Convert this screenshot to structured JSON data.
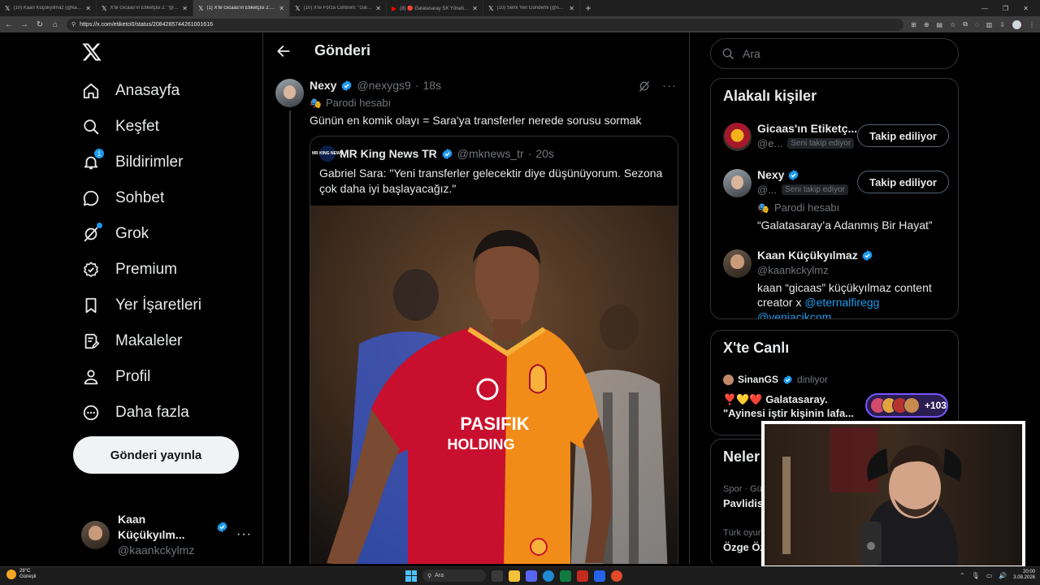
{
  "browser": {
    "tabs": [
      {
        "title": "(10) Kaan Küçükyılmaz (@kaankc",
        "icon": "x-icon",
        "active": false
      },
      {
        "title": "X'te Gicaas'ın Etiketçisi 2: \"@forzag",
        "icon": "x-icon",
        "active": false
      },
      {
        "title": "(1) X'te Gicaas'ın Etiketçisi 2: \"@ne",
        "icon": "x-icon",
        "active": true
      },
      {
        "title": "(10) X'te Forza Cimbom: \"Galatas",
        "icon": "x-icon",
        "active": false
      },
      {
        "title": "(8) 🔴 Galatasaray SK Yönetim Ku",
        "icon": "youtube-icon",
        "active": false
      },
      {
        "title": "(10) Semi Yeri Gündemi (@semiyer",
        "icon": "x-icon",
        "active": false
      }
    ],
    "url": "https://x.com/etiketci0/status/2084285744261001616"
  },
  "sidebar": {
    "nav": [
      {
        "label": "Anasayfa",
        "icon": "home-icon"
      },
      {
        "label": "Keşfet",
        "icon": "search-icon"
      },
      {
        "label": "Bildirimler",
        "icon": "bell-icon",
        "badge": "1"
      },
      {
        "label": "Sohbet",
        "icon": "chat-icon"
      },
      {
        "label": "Grok",
        "icon": "grok-icon"
      },
      {
        "label": "Premium",
        "icon": "premium-icon"
      },
      {
        "label": "Yer İşaretleri",
        "icon": "bookmark-icon"
      },
      {
        "label": "Makaleler",
        "icon": "articles-icon"
      },
      {
        "label": "Profil",
        "icon": "profile-icon"
      },
      {
        "label": "Daha fazla",
        "icon": "more-circle-icon"
      }
    ],
    "post_button": "Gönderi yayınla",
    "account": {
      "name": "Kaan Küçükyılm...",
      "handle": "@kaankckylmz"
    }
  },
  "main": {
    "title": "Gönderi",
    "tweet": {
      "name": "Nexy",
      "handle": "@nexygs9",
      "separator": "·",
      "time": "18s",
      "parody_label": "Parodi hesabı",
      "text": "Günün en komik olayı = Sara'ya transferler nerede sorusu sormak",
      "quote": {
        "logo_text": "MR KING NEWS",
        "name": "MR King News TR",
        "handle": "@mknews_tr",
        "separator": "·",
        "time": "20s",
        "text": "Gabriel Sara: \"Yeni transferler gelecektir diye düşünüyorum. Sezona çok daha iyi başlayacağız.\"",
        "image": {
          "sponsor_line1": "PASIFIK",
          "sponsor_line2": "HOLDING"
        }
      }
    }
  },
  "right": {
    "search_placeholder": "Ara",
    "related": {
      "title": "Alakalı kişiler",
      "people": [
        {
          "name": "Gicaas'ın Etiketç...",
          "handle": "@e...",
          "follows_you": "Seni takip ediyor",
          "button": "Takip ediliyor",
          "verified": false
        },
        {
          "name": "Nexy",
          "handle": "@...",
          "follows_you": "Seni takip ediyor",
          "button": "Takip ediliyor",
          "verified": true,
          "parody": "Parodi hesabı",
          "bio": "“Galatasaray’a Adanmış Bir Hayat”"
        },
        {
          "name": "Kaan Küçükyılmaz",
          "handle": "@kaankckylmz",
          "verified": true,
          "bio_prefix": "kaan “gicaas” küçükyılmaz content creator x ",
          "bio_link1": "@eternalfiregg",
          "bio_link2": "@yeniacikcom"
        }
      ]
    },
    "live": {
      "title": "X'te Canlı",
      "host": "SinanGS",
      "host_status": "dinliyor",
      "emojis": "❣️💛❤️",
      "space_title_line1": "Galatasaray.",
      "space_title_line2": "\"Ayinesi iştir kişinin lafa...",
      "listeners": "+103"
    },
    "happening": {
      "title": "Neler",
      "items": [
        {
          "category": "Spor · Gü",
          "name": "Pavlidis"
        },
        {
          "category": "Türk oyun",
          "name": "Özge Öz"
        }
      ]
    }
  },
  "taskbar": {
    "weather_temp": "28°C",
    "weather_desc": "Güneşli",
    "search": "Ara",
    "time": "20:00",
    "date": "3.08.2026"
  },
  "colors": {
    "accent": "#1d9bf0",
    "border": "#2f3336",
    "muted": "#71767b",
    "space_purple": "#7856ff"
  }
}
